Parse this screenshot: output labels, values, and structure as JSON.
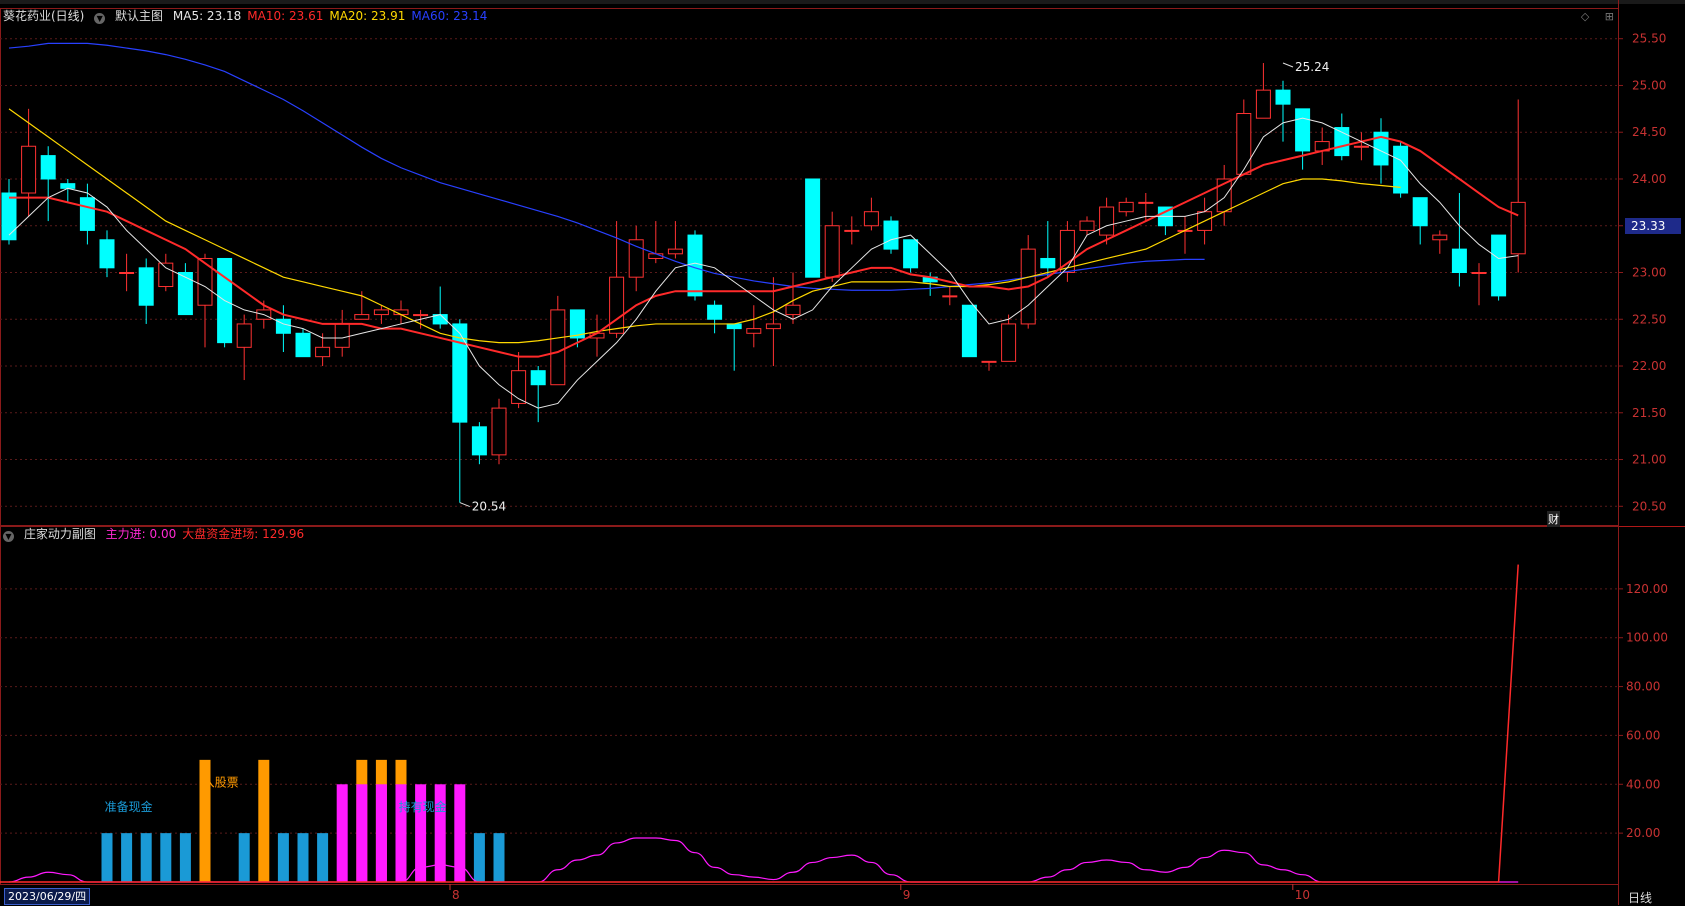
{
  "header": {
    "stock_name": "葵花药业(日线)",
    "main_chart_label": "默认主图",
    "indicators": [
      {
        "label": "MA5: 23.18",
        "color": "#e6e6e6"
      },
      {
        "label": "MA10: 23.61",
        "color": "#ff2a2a"
      },
      {
        "label": "MA20: 23.91",
        "color": "#ffd800"
      },
      {
        "label": "MA60: 23.14",
        "color": "#2840ff"
      }
    ]
  },
  "sub_header": {
    "name": "庄家动力副图",
    "indicators": [
      {
        "label": "主力进: 0.00",
        "color": "#ff2ad4"
      },
      {
        "label": "大盘资金进场: 129.96",
        "color": "#ff2a2a"
      }
    ]
  },
  "current_price": "23.33",
  "footer": {
    "date": "2023/06/29/四",
    "period": "日线",
    "finance_badge": "财"
  },
  "chart_data": [
    {
      "type": "candlestick",
      "title": "葵花药业(日线)",
      "colors": {
        "up": "#ff3232",
        "down": "#00ffff",
        "ma5": "#e6e6e6",
        "ma10": "#ff2a2a",
        "ma20": "#ffd800",
        "ma60": "#2840ff"
      },
      "ylim": [
        20.3,
        25.7
      ],
      "y_ticks": [
        20.5,
        21.0,
        21.5,
        22.0,
        22.5,
        23.0,
        23.5,
        24.0,
        24.5,
        25.0,
        25.5
      ],
      "x_month_labels": [
        {
          "index": 23,
          "label": "8"
        },
        {
          "index": 46,
          "label": "9"
        },
        {
          "index": 66,
          "label": "10"
        }
      ],
      "annotations": [
        {
          "index": 65,
          "price": 25.24,
          "text": "25.24"
        },
        {
          "index": 23,
          "price": 20.54,
          "text": "20.54"
        }
      ],
      "candles": [
        [
          23.85,
          23.35,
          24.0,
          23.3
        ],
        [
          23.85,
          24.35,
          24.75,
          23.6
        ],
        [
          24.25,
          24.0,
          24.35,
          23.55
        ],
        [
          23.95,
          23.9,
          24.0,
          23.75
        ],
        [
          23.8,
          23.45,
          23.95,
          23.3
        ],
        [
          23.35,
          23.05,
          23.45,
          22.95
        ],
        [
          23.0,
          23.0,
          23.2,
          22.8
        ],
        [
          23.05,
          22.65,
          23.15,
          22.45
        ],
        [
          22.85,
          23.1,
          23.2,
          22.8
        ],
        [
          23.0,
          22.55,
          23.1,
          22.55
        ],
        [
          22.65,
          23.15,
          23.2,
          22.2
        ],
        [
          23.15,
          22.25,
          23.15,
          22.2
        ],
        [
          22.2,
          22.45,
          22.55,
          21.85
        ],
        [
          22.5,
          22.6,
          22.7,
          22.4
        ],
        [
          22.5,
          22.35,
          22.65,
          22.15
        ],
        [
          22.35,
          22.1,
          22.4,
          22.1
        ],
        [
          22.1,
          22.2,
          22.35,
          22.0
        ],
        [
          22.2,
          22.45,
          22.6,
          22.1
        ],
        [
          22.5,
          22.55,
          22.8,
          22.5
        ],
        [
          22.55,
          22.6,
          22.65,
          22.45
        ],
        [
          22.55,
          22.6,
          22.7,
          22.45
        ],
        [
          22.55,
          22.55,
          22.6,
          22.4
        ],
        [
          22.55,
          22.45,
          22.85,
          22.4
        ],
        [
          22.45,
          21.4,
          22.5,
          20.54
        ],
        [
          21.35,
          21.05,
          21.4,
          20.95
        ],
        [
          21.05,
          21.55,
          21.65,
          20.95
        ],
        [
          21.6,
          21.95,
          22.15,
          21.55
        ],
        [
          21.95,
          21.8,
          22.0,
          21.4
        ],
        [
          21.8,
          22.6,
          22.75,
          21.8
        ],
        [
          22.6,
          22.3,
          22.6,
          22.2
        ],
        [
          22.3,
          22.35,
          22.55,
          22.1
        ],
        [
          22.35,
          22.95,
          23.55,
          22.3
        ],
        [
          22.95,
          23.35,
          23.5,
          22.8
        ],
        [
          23.15,
          23.2,
          23.55,
          23.1
        ],
        [
          23.2,
          23.25,
          23.55,
          23.15
        ],
        [
          23.4,
          22.75,
          23.45,
          22.7
        ],
        [
          22.65,
          22.5,
          22.7,
          22.35
        ],
        [
          22.45,
          22.4,
          22.45,
          21.95
        ],
        [
          22.35,
          22.4,
          22.65,
          22.2
        ],
        [
          22.4,
          22.45,
          22.95,
          22.0
        ],
        [
          22.55,
          22.65,
          23.0,
          22.45
        ],
        [
          24.0,
          22.95,
          24.0,
          22.95
        ],
        [
          22.95,
          23.5,
          23.65,
          22.9
        ],
        [
          23.45,
          23.45,
          23.6,
          23.3
        ],
        [
          23.5,
          23.65,
          23.8,
          23.45
        ],
        [
          23.55,
          23.25,
          23.6,
          23.2
        ],
        [
          23.35,
          23.05,
          23.35,
          23.0
        ],
        [
          22.95,
          22.9,
          23.0,
          22.75
        ],
        [
          22.75,
          22.75,
          22.85,
          22.65
        ],
        [
          22.65,
          22.1,
          22.65,
          22.1
        ],
        [
          22.05,
          22.05,
          22.05,
          21.95
        ],
        [
          22.05,
          22.45,
          22.55,
          22.05
        ],
        [
          22.45,
          23.25,
          23.4,
          22.4
        ],
        [
          23.15,
          23.05,
          23.55,
          22.95
        ],
        [
          23.0,
          23.45,
          23.55,
          22.9
        ],
        [
          23.45,
          23.55,
          23.6,
          23.4
        ],
        [
          23.4,
          23.7,
          23.8,
          23.3
        ],
        [
          23.65,
          23.75,
          23.8,
          23.6
        ],
        [
          23.75,
          23.75,
          23.85,
          23.55
        ],
        [
          23.7,
          23.5,
          23.7,
          23.4
        ],
        [
          23.45,
          23.45,
          23.6,
          23.2
        ],
        [
          23.45,
          23.65,
          23.8,
          23.3
        ],
        [
          23.65,
          24.0,
          24.15,
          23.5
        ],
        [
          24.05,
          24.7,
          24.85,
          24.05
        ],
        [
          24.65,
          24.95,
          25.24,
          24.65
        ],
        [
          24.95,
          24.8,
          25.05,
          24.4
        ],
        [
          24.75,
          24.3,
          24.75,
          24.1
        ],
        [
          24.3,
          24.4,
          24.55,
          24.15
        ],
        [
          24.55,
          24.25,
          24.7,
          24.2
        ],
        [
          24.35,
          24.35,
          24.5,
          24.2
        ],
        [
          24.5,
          24.15,
          24.65,
          23.95
        ],
        [
          24.35,
          23.85,
          24.4,
          23.8
        ],
        [
          23.8,
          23.5,
          23.8,
          23.3
        ],
        [
          23.35,
          23.4,
          23.45,
          23.2
        ],
        [
          23.25,
          23.0,
          23.85,
          22.85
        ],
        [
          23.0,
          23.0,
          23.1,
          22.65
        ],
        [
          23.4,
          22.75,
          23.4,
          22.7
        ],
        [
          23.2,
          23.75,
          24.85,
          23.0
        ]
      ],
      "ma5": [
        23.4,
        23.6,
        23.8,
        23.9,
        23.85,
        23.7,
        23.45,
        23.25,
        23.05,
        22.95,
        22.85,
        22.7,
        22.6,
        22.55,
        22.45,
        22.4,
        22.3,
        22.3,
        22.35,
        22.4,
        22.45,
        22.5,
        22.55,
        22.35,
        22.0,
        21.8,
        21.65,
        21.55,
        21.6,
        21.85,
        22.05,
        22.25,
        22.5,
        22.8,
        23.05,
        23.1,
        23.05,
        22.9,
        22.75,
        22.6,
        22.5,
        22.6,
        22.85,
        23.05,
        23.25,
        23.35,
        23.4,
        23.2,
        23.0,
        22.7,
        22.45,
        22.5,
        22.65,
        22.85,
        23.05,
        23.4,
        23.5,
        23.55,
        23.6,
        23.6,
        23.6,
        23.65,
        23.8,
        24.1,
        24.45,
        24.6,
        24.65,
        24.6,
        24.5,
        24.4,
        24.3,
        24.2,
        23.95,
        23.75,
        23.5,
        23.3,
        23.15,
        23.18
      ],
      "ma10": [
        23.8,
        23.8,
        23.8,
        23.75,
        23.7,
        23.65,
        23.55,
        23.45,
        23.35,
        23.25,
        23.1,
        22.95,
        22.8,
        22.65,
        22.55,
        22.5,
        22.45,
        22.45,
        22.45,
        22.4,
        22.4,
        22.35,
        22.3,
        22.25,
        22.2,
        22.15,
        22.1,
        22.1,
        22.15,
        22.25,
        22.35,
        22.5,
        22.65,
        22.75,
        22.8,
        22.8,
        22.8,
        22.8,
        22.8,
        22.8,
        22.85,
        22.9,
        22.95,
        23.0,
        23.05,
        23.05,
        22.98,
        22.95,
        22.9,
        22.85,
        22.85,
        22.82,
        22.85,
        22.95,
        23.1,
        23.25,
        23.35,
        23.45,
        23.55,
        23.65,
        23.75,
        23.85,
        23.95,
        24.05,
        24.15,
        24.2,
        24.25,
        24.3,
        24.35,
        24.4,
        24.45,
        24.4,
        24.3,
        24.15,
        24.0,
        23.85,
        23.7,
        23.61
      ],
      "ma20": [
        24.75,
        24.6,
        24.45,
        24.3,
        24.15,
        24.0,
        23.85,
        23.7,
        23.55,
        23.45,
        23.35,
        23.25,
        23.15,
        23.05,
        22.95,
        22.9,
        22.85,
        22.8,
        22.75,
        22.65,
        22.55,
        22.45,
        22.35,
        22.3,
        22.27,
        22.25,
        22.25,
        22.27,
        22.3,
        22.33,
        22.37,
        22.4,
        22.43,
        22.45,
        22.45,
        22.45,
        22.45,
        22.45,
        22.5,
        22.58,
        22.7,
        22.8,
        22.85,
        22.9,
        22.9,
        22.9,
        22.9,
        22.88,
        22.85,
        22.85,
        22.87,
        22.9,
        22.95,
        23.0,
        23.05,
        23.1,
        23.15,
        23.2,
        23.25,
        23.35,
        23.45,
        23.55,
        23.65,
        23.75,
        23.85,
        23.95,
        24.0,
        24.0,
        23.98,
        23.95,
        23.93,
        23.91
      ],
      "ma60": [
        25.4,
        25.42,
        25.45,
        25.45,
        25.45,
        25.43,
        25.4,
        25.37,
        25.33,
        25.28,
        25.22,
        25.15,
        25.05,
        24.95,
        24.85,
        24.73,
        24.6,
        24.47,
        24.34,
        24.22,
        24.12,
        24.04,
        23.96,
        23.9,
        23.84,
        23.78,
        23.72,
        23.66,
        23.6,
        23.53,
        23.45,
        23.37,
        23.28,
        23.2,
        23.12,
        23.05,
        22.99,
        22.95,
        22.91,
        22.88,
        22.85,
        22.83,
        22.82,
        22.81,
        22.81,
        22.81,
        22.82,
        22.83,
        22.85,
        22.87,
        22.89,
        22.92,
        22.95,
        22.98,
        23.01,
        23.04,
        23.07,
        23.1,
        23.12,
        23.13,
        23.14,
        23.14
      ]
    },
    {
      "type": "bar",
      "title": "庄家动力副图",
      "ylim": [
        0,
        140
      ],
      "y_ticks": [
        20.0,
        40.0,
        60.0,
        80.0,
        100.0,
        120.0
      ],
      "series": [
        {
          "name": "准备现金",
          "color": "#1a9ad6",
          "values": [
            {
              "index": 5,
              "v": 20
            },
            {
              "index": 6,
              "v": 20
            },
            {
              "index": 7,
              "v": 20
            },
            {
              "index": 8,
              "v": 20
            },
            {
              "index": 9,
              "v": 20
            },
            {
              "index": 10,
              "v": 20
            },
            {
              "index": 12,
              "v": 20
            },
            {
              "index": 14,
              "v": 20
            },
            {
              "index": 15,
              "v": 20
            },
            {
              "index": 16,
              "v": 20
            },
            {
              "index": 24,
              "v": 20
            },
            {
              "index": 25,
              "v": 20
            }
          ]
        },
        {
          "name": "入股票",
          "color": "#ff9a00",
          "values": [
            {
              "index": 10,
              "v": 50
            },
            {
              "index": 13,
              "v": 50
            },
            {
              "index": 18,
              "v": 50
            },
            {
              "index": 19,
              "v": 50
            },
            {
              "index": 20,
              "v": 50
            }
          ]
        },
        {
          "name": "",
          "color": "#ff1aff",
          "values": [
            {
              "index": 17,
              "v": 40
            },
            {
              "index": 18,
              "v": 40
            },
            {
              "index": 19,
              "v": 40
            },
            {
              "index": 20,
              "v": 40
            },
            {
              "index": 21,
              "v": 40
            },
            {
              "index": 22,
              "v": 40
            },
            {
              "index": 23,
              "v": 40
            }
          ]
        }
      ],
      "labels": [
        {
          "index": 6,
          "v": 29,
          "text": "准备现金",
          "color": "#1a9ad6"
        },
        {
          "index": 11,
          "v": 39,
          "text": "入股票",
          "color": "#ff9a00"
        },
        {
          "index": 21,
          "v": 29,
          "text": "持有现金",
          "color": "#1a9ad6"
        }
      ],
      "main_force_line": {
        "name": "主力进",
        "color": "#ff1aff",
        "values": [
          0,
          2,
          4,
          3,
          0,
          0,
          0,
          0,
          0,
          0,
          0,
          0,
          0,
          0,
          0,
          0,
          0,
          0,
          0,
          0,
          0,
          6,
          7,
          6,
          0,
          0,
          0,
          0,
          5,
          9,
          11,
          16,
          18,
          18,
          17,
          12,
          6,
          3,
          2,
          1,
          4,
          8,
          10,
          11,
          8,
          3,
          0,
          0,
          0,
          0,
          0,
          0,
          0,
          2,
          5,
          8,
          9,
          8,
          5,
          4,
          6,
          10,
          13,
          12,
          7,
          5,
          3,
          0,
          0,
          0,
          0,
          0,
          0,
          0,
          0,
          0,
          0,
          0
        ]
      },
      "inflow_line": {
        "name": "大盘资金进场",
        "color": "#ff2a2a",
        "values": [
          0,
          0,
          0,
          0,
          0,
          0,
          0,
          0,
          0,
          0,
          0,
          0,
          0,
          0,
          0,
          0,
          0,
          0,
          0,
          0,
          0,
          0,
          0,
          0,
          0,
          0,
          0,
          0,
          0,
          0,
          0,
          0,
          0,
          0,
          0,
          0,
          0,
          0,
          0,
          0,
          0,
          0,
          0,
          0,
          0,
          0,
          0,
          0,
          0,
          0,
          0,
          0,
          0,
          0,
          0,
          0,
          0,
          0,
          0,
          0,
          0,
          0,
          0,
          0,
          0,
          0,
          0,
          0,
          0,
          0,
          0,
          0,
          0,
          0,
          0,
          0,
          0,
          129.96
        ]
      }
    }
  ]
}
